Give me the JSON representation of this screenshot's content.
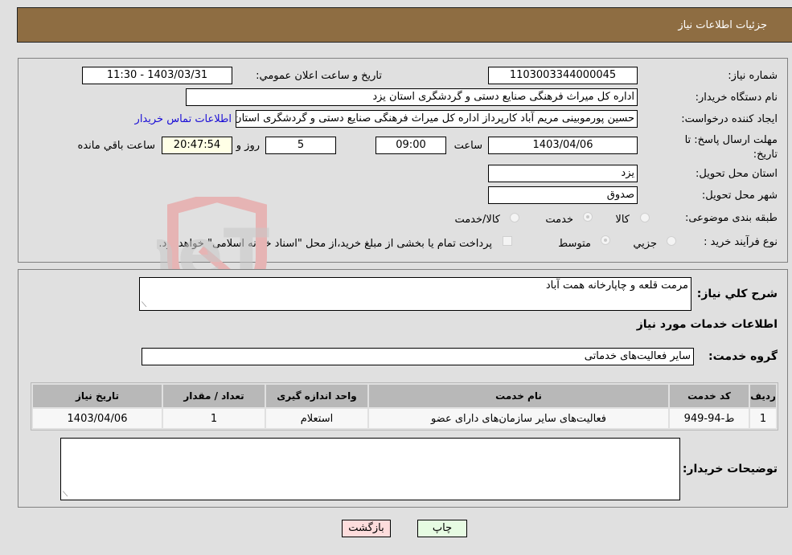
{
  "header": {
    "title": "جزئیات اطلاعات نیاز"
  },
  "info": {
    "need_number_label": "شماره نیاز:",
    "need_number": "1103003344000045",
    "announce_label": "تاریخ و ساعت اعلان عمومي:",
    "announce_value": "1403/03/31 - 11:30",
    "buyer_org_label": "نام دستگاه خریدار:",
    "buyer_org": "اداره کل میراث فرهنگی  صنایع دستی و گردشگری استان یزد",
    "requester_label": "ایجاد کننده درخواست:",
    "requester": "حسین پورموبینی مریم آباد کارپرداز اداره کل میراث فرهنگی  صنایع دستی و گردشگری استان یزد",
    "contact_link": "اطلاعات تماس خریدار",
    "deadline_label": "مهلت ارسال پاسخ: تا تاریخ:",
    "deadline_date": "1403/04/06",
    "time_label": "ساعت",
    "deadline_time": "09:00",
    "days_value": "5",
    "days_label": "روز و",
    "remaining_time": "20:47:54",
    "remaining_label": "ساعت باقي مانده",
    "province_label": "استان محل تحویل:",
    "province": "یزد",
    "city_label": "شهر محل تحویل:",
    "city": "صدوق",
    "category_label": "طبقه بندی موضوعی:",
    "category_options": [
      {
        "label": "کالا",
        "selected": false
      },
      {
        "label": "خدمت",
        "selected": true
      },
      {
        "label": "کالا/خدمت",
        "selected": false
      }
    ],
    "purchase_type_label": "نوع فرآیند خرید :",
    "purchase_type_options": [
      {
        "label": "جزيي",
        "selected": false
      },
      {
        "label": "متوسط",
        "selected": true
      }
    ],
    "treasury_note": "پرداخت تمام یا بخشی از مبلغ خرید،از محل \"اسناد خزانه اسلامی\" خواهد بود.",
    "treasury_checked": false
  },
  "details": {
    "description_label": "شرح کلي نیاز:",
    "description": "مرمت قلعه و چاپارخانه همت آباد",
    "services_heading": "اطلاعات خدمات مورد نیاز",
    "service_group_label": "گروه خدمت:",
    "service_group": "سایر فعالیت‌های خدماتی",
    "table": {
      "headers": [
        "ردیف",
        "کد خدمت",
        "نام خدمت",
        "واحد اندازه گیری",
        "تعداد / مقدار",
        "تاریخ نیاز"
      ],
      "rows": [
        [
          "1",
          "ط-94-949",
          "فعالیت‌های سایر سازمان‌های دارای عضو",
          "استعلام",
          "1",
          "1403/04/06"
        ]
      ]
    },
    "buyer_notes_label": "توضیحات خریدار:",
    "buyer_notes": ""
  },
  "buttons": {
    "print": "چاپ",
    "back": "بازگشت"
  },
  "watermark": {
    "text": "AriaTender.neT"
  }
}
